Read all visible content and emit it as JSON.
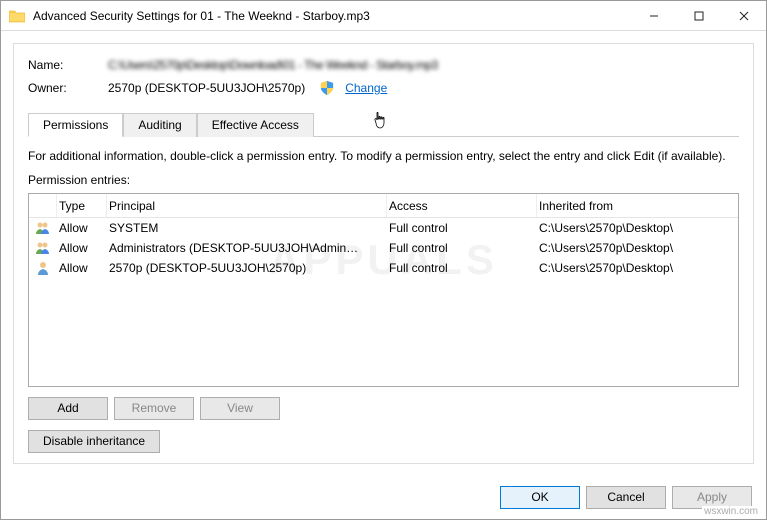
{
  "window": {
    "title": "Advanced Security Settings for 01 - The Weeknd - Starboy.mp3"
  },
  "header": {
    "name_label": "Name:",
    "name_value": "C:\\Users\\2570p\\Desktop\\Download\\01 - The Weeknd - Starboy.mp3",
    "owner_label": "Owner:",
    "owner_value": "2570p (DESKTOP-5UU3JOH\\2570p)",
    "change_label": "Change"
  },
  "tabs": {
    "permissions": "Permissions",
    "auditing": "Auditing",
    "effective": "Effective Access"
  },
  "info_text": "For additional information, double-click a permission entry. To modify a permission entry, select the entry and click Edit (if available).",
  "entries_label": "Permission entries:",
  "columns": {
    "type": "Type",
    "principal": "Principal",
    "access": "Access",
    "inherited": "Inherited from"
  },
  "entries": [
    {
      "type": "Allow",
      "principal": "SYSTEM",
      "access": "Full control",
      "inherited": "C:\\Users\\2570p\\Desktop\\"
    },
    {
      "type": "Allow",
      "principal": "Administrators (DESKTOP-5UU3JOH\\Admin…",
      "access": "Full control",
      "inherited": "C:\\Users\\2570p\\Desktop\\"
    },
    {
      "type": "Allow",
      "principal": "2570p (DESKTOP-5UU3JOH\\2570p)",
      "access": "Full control",
      "inherited": "C:\\Users\\2570p\\Desktop\\"
    }
  ],
  "buttons": {
    "add": "Add",
    "remove": "Remove",
    "view": "View",
    "disable_inherit": "Disable inheritance",
    "ok": "OK",
    "cancel": "Cancel",
    "apply": "Apply"
  },
  "watermark": "wsxwin.com"
}
